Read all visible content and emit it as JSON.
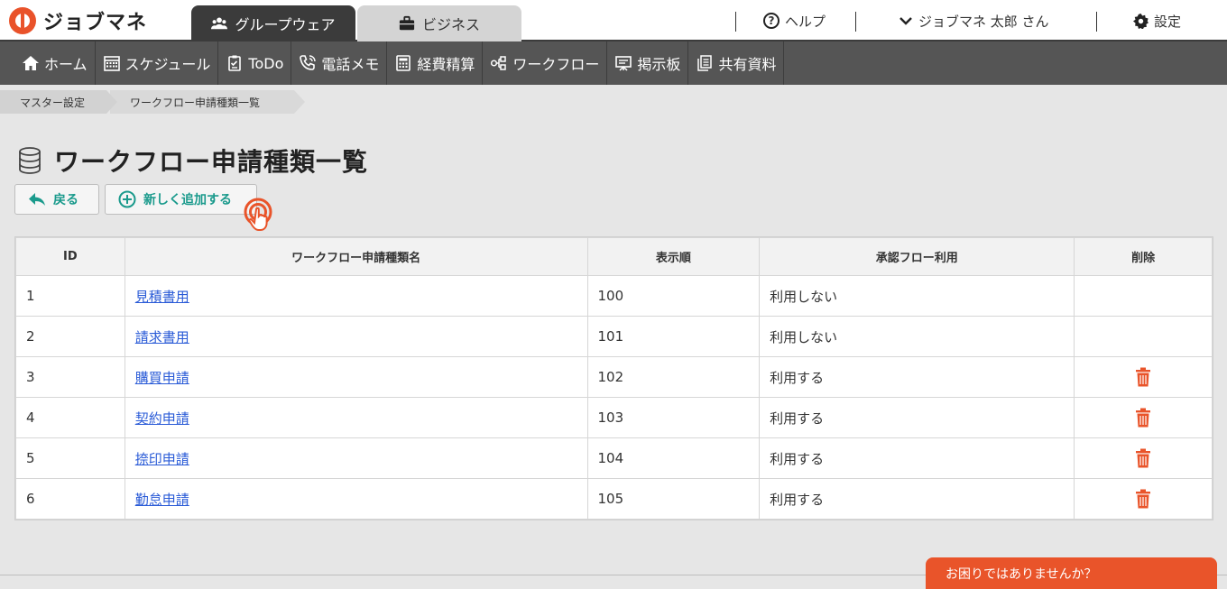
{
  "app": {
    "logo_text": "ジョブマネ",
    "brand_color": "#e9522a",
    "accent_color": "#1a9a8c"
  },
  "tabs": [
    {
      "label": "グループウェア",
      "icon": "users-icon",
      "active": true
    },
    {
      "label": "ビジネス",
      "icon": "briefcase-icon",
      "active": false
    }
  ],
  "header": {
    "help": "ヘルプ",
    "user": "ジョブマネ 太郎 さん",
    "settings": "設定"
  },
  "nav": [
    {
      "label": "ホーム",
      "icon": "home-icon"
    },
    {
      "label": "スケジュール",
      "icon": "calendar-icon"
    },
    {
      "label": "ToDo",
      "icon": "checklist-icon"
    },
    {
      "label": "電話メモ",
      "icon": "phone-icon"
    },
    {
      "label": "経費精算",
      "icon": "calculator-icon"
    },
    {
      "label": "ワークフロー",
      "icon": "workflow-icon"
    },
    {
      "label": "掲示板",
      "icon": "board-icon"
    },
    {
      "label": "共有資料",
      "icon": "documents-icon"
    }
  ],
  "breadcrumb": [
    "マスター設定",
    "ワークフロー申請種類一覧"
  ],
  "page": {
    "title": "ワークフロー申請種類一覧",
    "back_label": "戻る",
    "add_label": "新しく追加する"
  },
  "table": {
    "headers": [
      "ID",
      "ワークフロー申請種類名",
      "表示順",
      "承認フロー利用",
      "削除"
    ],
    "rows": [
      {
        "id": "1",
        "name": "見積書用",
        "order": "100",
        "approval": "利用しない",
        "deletable": false
      },
      {
        "id": "2",
        "name": "請求書用",
        "order": "101",
        "approval": "利用しない",
        "deletable": false
      },
      {
        "id": "3",
        "name": "購買申請",
        "order": "102",
        "approval": "利用する",
        "deletable": true
      },
      {
        "id": "4",
        "name": "契約申請",
        "order": "103",
        "approval": "利用する",
        "deletable": true
      },
      {
        "id": "5",
        "name": "捺印申請",
        "order": "104",
        "approval": "利用する",
        "deletable": true
      },
      {
        "id": "6",
        "name": "勤怠申請",
        "order": "105",
        "approval": "利用する",
        "deletable": true
      }
    ]
  },
  "footer": {
    "help_button": "お困りではありませんか？"
  }
}
